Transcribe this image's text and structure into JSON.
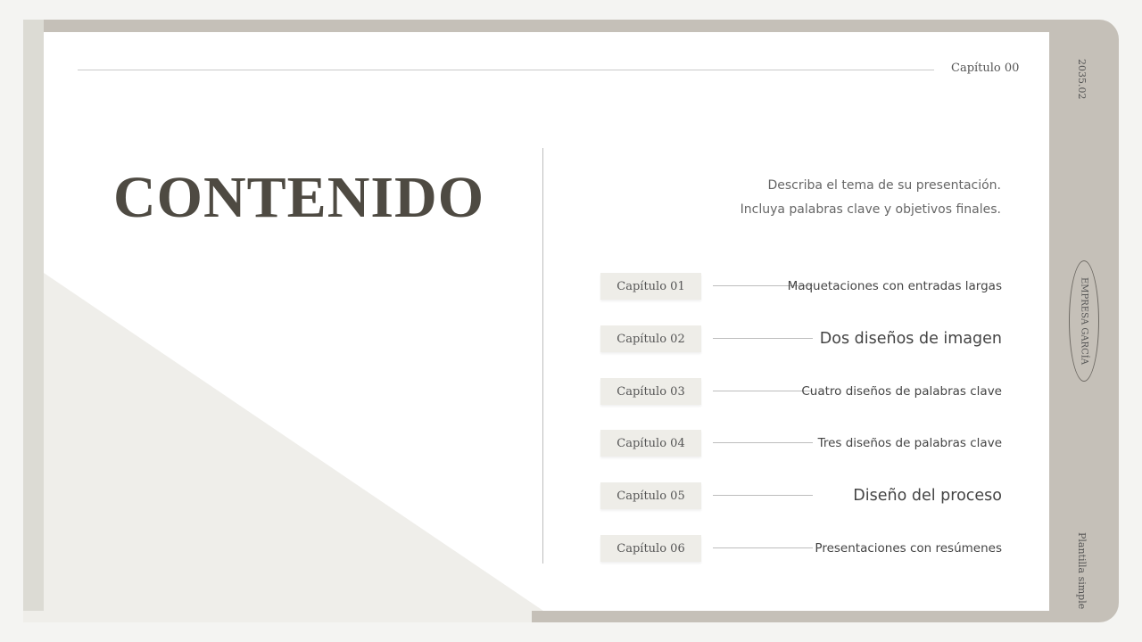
{
  "header": {
    "chapter_label": "Capítulo 00"
  },
  "title": "CONTENIDO",
  "description": {
    "line1": "Describa el tema de su presentación.",
    "line2": "Incluya palabras clave y objetivos finales."
  },
  "chapters": [
    {
      "tag": "Capítulo 01",
      "label": "Maquetaciones con entradas largas"
    },
    {
      "tag": "Capítulo 02",
      "label": "Dos diseños de imagen"
    },
    {
      "tag": "Capítulo 03",
      "label": "Cuatro diseños de palabras clave"
    },
    {
      "tag": "Capítulo 04",
      "label": "Tres diseños de palabras clave"
    },
    {
      "tag": "Capítulo 05",
      "label": "Diseño del proceso"
    },
    {
      "tag": "Capítulo 06",
      "label": "Presentaciones con resúmenes"
    }
  ],
  "side": {
    "date": "2035.02",
    "company": "EMPRESA GARCÍA",
    "template": "Plantilla simple"
  },
  "colors": {
    "frame": "#c5c0b8",
    "accent_light": "#efeeea",
    "title": "#4e4a42"
  }
}
